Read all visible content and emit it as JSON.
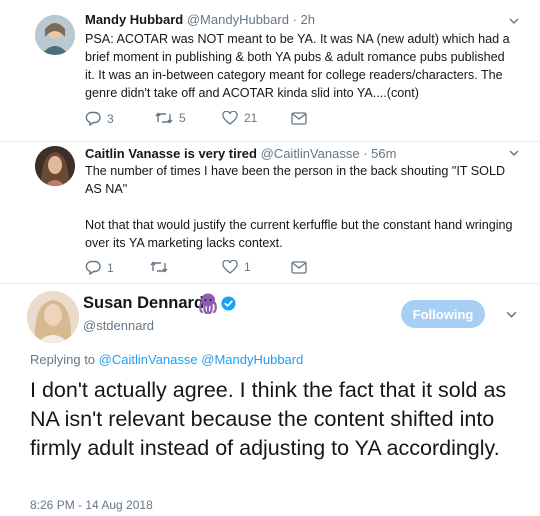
{
  "reply1": {
    "name": "Mandy Hubbard",
    "handle": "@MandyHubbard",
    "time": "2h",
    "text": "PSA: ACOTAR was NOT meant to be YA. It was NA (new adult) which had a brief moment in publishing & both YA pubs & adult romance pubs published it. It was an in-between category meant for college readers/characters. The genre didn't take off and ACOTAR kinda slid into YA....(cont)",
    "reply_count": "3",
    "retweet_count": "5",
    "like_count": "21"
  },
  "reply2": {
    "name": "Caitlin Vanasse is very tired",
    "handle": "@CaitlinVanasse",
    "time": "56m",
    "text_p1": "The number of times I have been the person in the back shouting \"IT SOLD AS NA\"",
    "text_p2": "Not that that would justify the current kerfuffle but the constant hand wringing over its YA marketing lacks context.",
    "reply_count": "1",
    "retweet_count": "",
    "like_count": "1"
  },
  "main": {
    "name": "Susan Dennard",
    "handle": "@stdennard",
    "follow_label": "Following",
    "replying_prefix": "Replying to",
    "replying_to_1": "@CaitlinVanasse",
    "replying_to_2": "@MandyHubbard",
    "text": "I don't actually agree. I think the fact that it sold as NA isn't relevant because the content shifted into firmly adult instead of adjusting to YA accordingly.",
    "timestamp": "8:26 PM - 14 Aug 2018"
  },
  "colors": {
    "accent": "#1da1f2",
    "follow_button": "#a7cff5",
    "muted": "#657786",
    "text": "#14171a",
    "verified": "#1da1f2",
    "octopus": "#8e5bb5"
  },
  "icons": [
    "chevron-down-icon",
    "reply-icon",
    "retweet-icon",
    "heart-icon",
    "dm-envelope-icon",
    "octopus-emoji-icon",
    "verified-badge-icon"
  ]
}
